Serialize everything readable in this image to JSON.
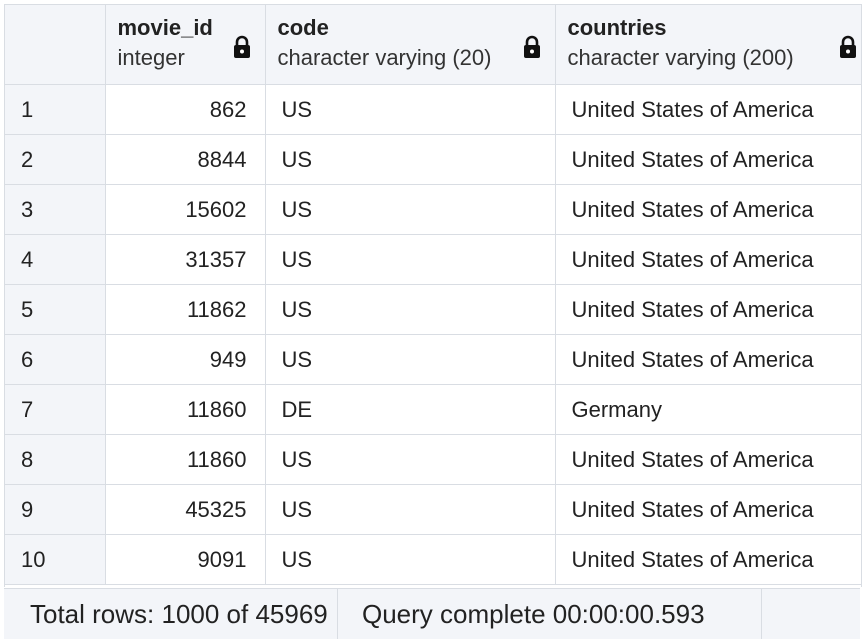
{
  "grid": {
    "columns": [
      {
        "name": "movie_id",
        "type": "integer",
        "locked": true
      },
      {
        "name": "code",
        "type": "character varying (20)",
        "locked": true
      },
      {
        "name": "countries",
        "type": "character varying (200)",
        "locked": true
      }
    ],
    "rows": [
      {
        "n": "1",
        "movie_id": "862",
        "code": "US",
        "countries": "United States of America"
      },
      {
        "n": "2",
        "movie_id": "8844",
        "code": "US",
        "countries": "United States of America"
      },
      {
        "n": "3",
        "movie_id": "15602",
        "code": "US",
        "countries": "United States of America"
      },
      {
        "n": "4",
        "movie_id": "31357",
        "code": "US",
        "countries": "United States of America"
      },
      {
        "n": "5",
        "movie_id": "11862",
        "code": "US",
        "countries": "United States of America"
      },
      {
        "n": "6",
        "movie_id": "949",
        "code": "US",
        "countries": "United States of America"
      },
      {
        "n": "7",
        "movie_id": "11860",
        "code": "DE",
        "countries": "Germany"
      },
      {
        "n": "8",
        "movie_id": "11860",
        "code": "US",
        "countries": "United States of America"
      },
      {
        "n": "9",
        "movie_id": "45325",
        "code": "US",
        "countries": "United States of America"
      },
      {
        "n": "10",
        "movie_id": "9091",
        "code": "US",
        "countries": "United States of America"
      }
    ]
  },
  "status": {
    "total_rows": "Total rows: 1000 of 45969",
    "query": "Query complete 00:00:00.593"
  },
  "icons": {
    "column_lock": "lock-icon"
  },
  "colors": {
    "header_bg": "#f3f5f9",
    "border": "#d9dde3",
    "cell_bg": "#ffffff",
    "text": "#222222"
  }
}
